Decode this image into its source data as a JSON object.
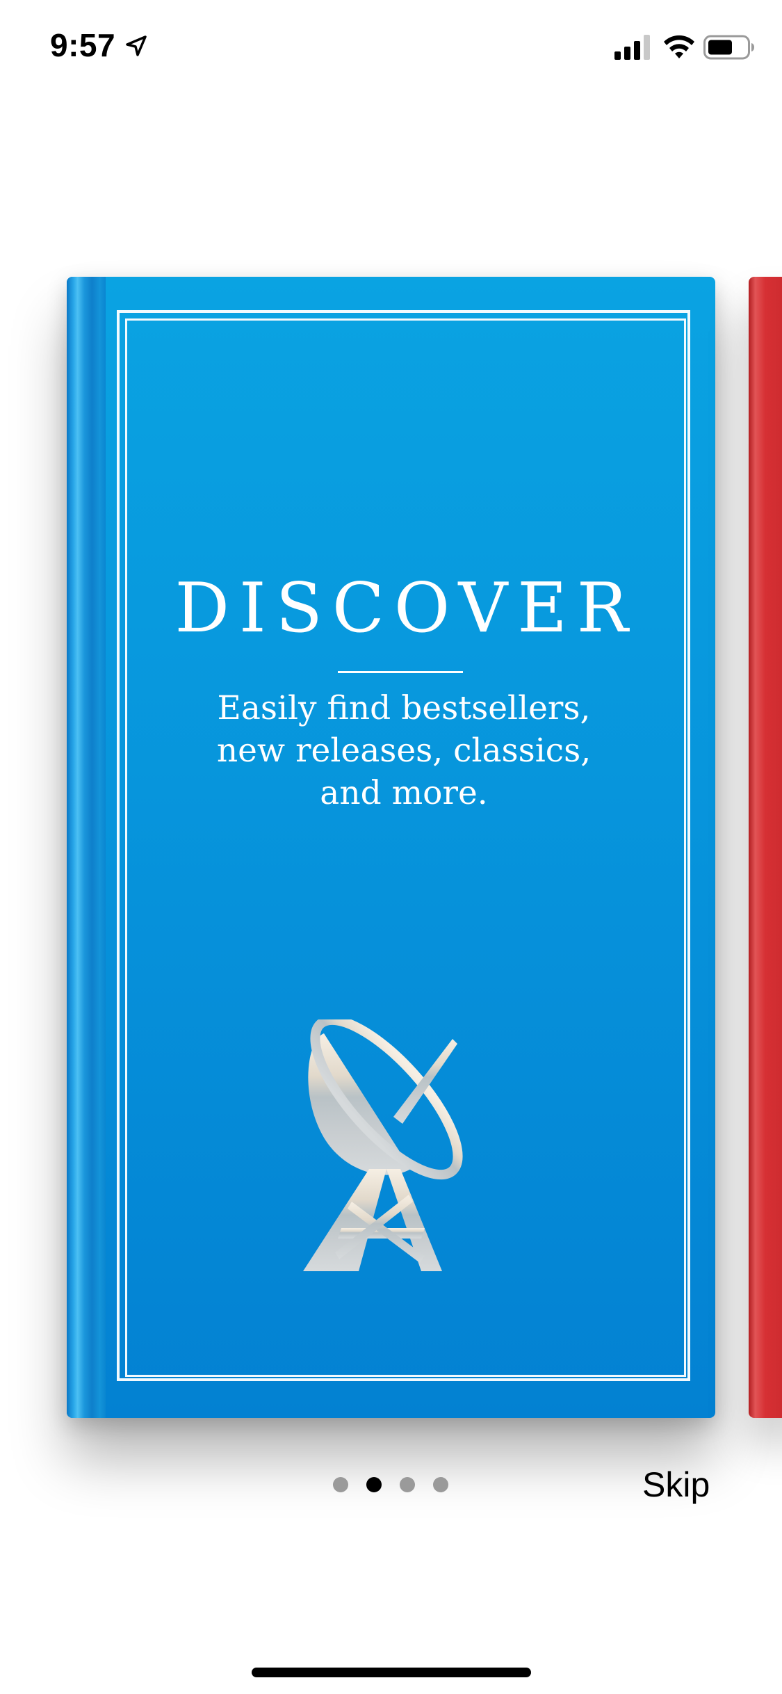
{
  "status_bar": {
    "time": "9:57",
    "icons": [
      "location-arrow-icon",
      "signal-icon",
      "wifi-icon",
      "battery-icon"
    ]
  },
  "book": {
    "title": "DISCOVER",
    "subtitle": "Easily find bestsellers,\nnew releases, classics,\nand more.",
    "illustration": "satellite-dish-icon",
    "cover_color": "#0795dc"
  },
  "next_book": {
    "cover_color": "#d63034"
  },
  "pager": {
    "page_count": 4,
    "active_index": 1
  },
  "skip_label": "Skip"
}
